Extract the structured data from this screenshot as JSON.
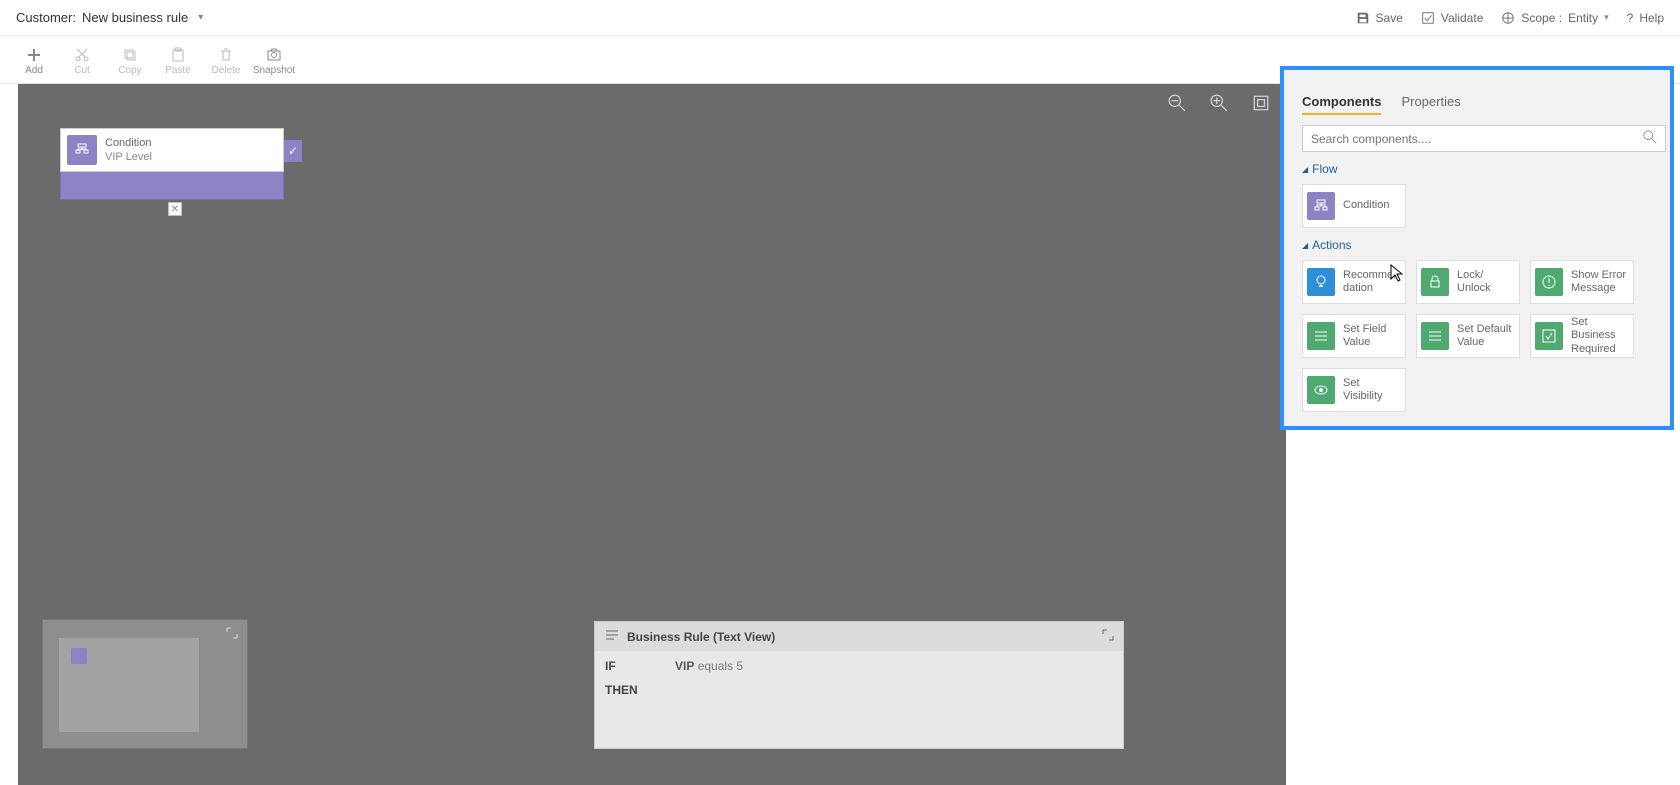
{
  "header": {
    "entity_label": "Customer:",
    "rule_name": "New business rule",
    "save": "Save",
    "validate": "Validate",
    "scope_label": "Scope :",
    "scope_value": "Entity",
    "help": "Help"
  },
  "toolbar": {
    "add": "Add",
    "cut": "Cut",
    "copy": "Copy",
    "paste": "Paste",
    "delete": "Delete",
    "snapshot": "Snapshot"
  },
  "canvas": {
    "condition": {
      "title": "Condition",
      "subtitle": "VIP Level"
    },
    "textview": {
      "title": "Business Rule (Text View)",
      "if": "IF",
      "then": "THEN",
      "field": "VIP",
      "op": "equals",
      "val": "5"
    }
  },
  "panel": {
    "tabs": {
      "components": "Components",
      "properties": "Properties"
    },
    "search_placeholder": "Search components....",
    "flow_label": "Flow",
    "actions_label": "Actions",
    "condition": "Condition",
    "recommendation": "Recommendation",
    "lock": "Lock/\nUnlock",
    "show_error": "Show Error Message",
    "set_field": "Set Field Value",
    "set_default": "Set Default Value",
    "set_required": "Set Business Required",
    "set_visibility": "Set Visibility"
  }
}
